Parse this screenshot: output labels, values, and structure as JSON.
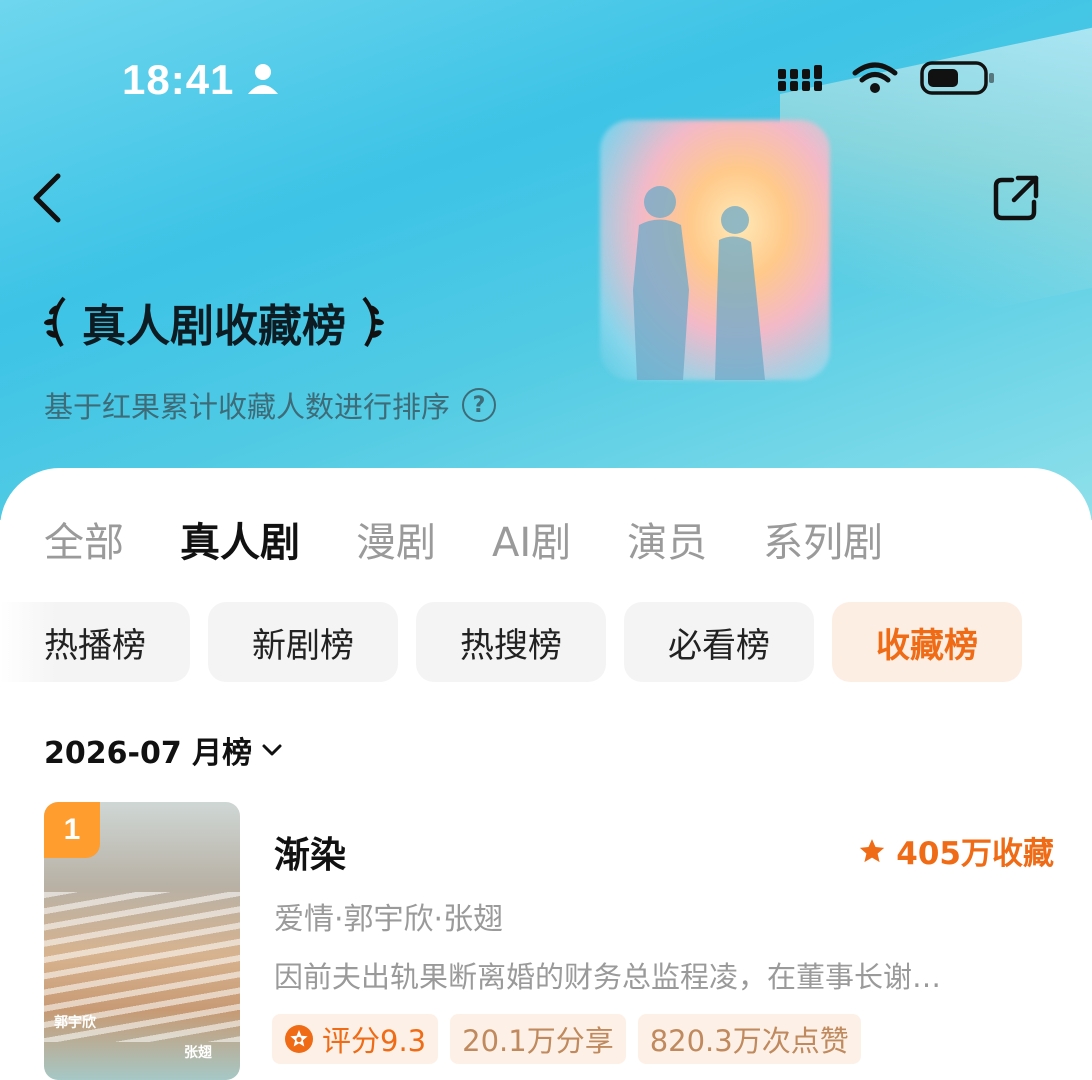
{
  "status_bar": {
    "time": "18:41"
  },
  "header": {
    "title": "真人剧收藏榜",
    "subtitle": "基于红果累计收藏人数进行排序"
  },
  "tabs": [
    {
      "label": "全部",
      "active": false
    },
    {
      "label": "真人剧",
      "active": true
    },
    {
      "label": "漫剧",
      "active": false
    },
    {
      "label": "AI剧",
      "active": false
    },
    {
      "label": "演员",
      "active": false
    },
    {
      "label": "系列剧",
      "active": false
    }
  ],
  "chips": [
    {
      "label": "热播榜",
      "active": false
    },
    {
      "label": "新剧榜",
      "active": false
    },
    {
      "label": "热搜榜",
      "active": false
    },
    {
      "label": "必看榜",
      "active": false
    },
    {
      "label": "收藏榜",
      "active": true
    }
  ],
  "period": {
    "label": "2026-07 月榜"
  },
  "list": [
    {
      "rank": "1",
      "title": "渐染",
      "collections": "405万收藏",
      "meta": "爱情·郭宇欣·张翅",
      "description": "因前夫出轨果断离婚的财务总监程凌，在董事长谢…",
      "tags": [
        "评分9.3",
        "20.1万分享",
        "820.3万次点赞"
      ],
      "poster_text": {
        "name_left": "郭宇欣",
        "name_right": "张翅"
      }
    }
  ],
  "colors": {
    "accent": "#f06b16",
    "hero": "#3cc3e6",
    "rank_badge": "#ff9d2e"
  }
}
